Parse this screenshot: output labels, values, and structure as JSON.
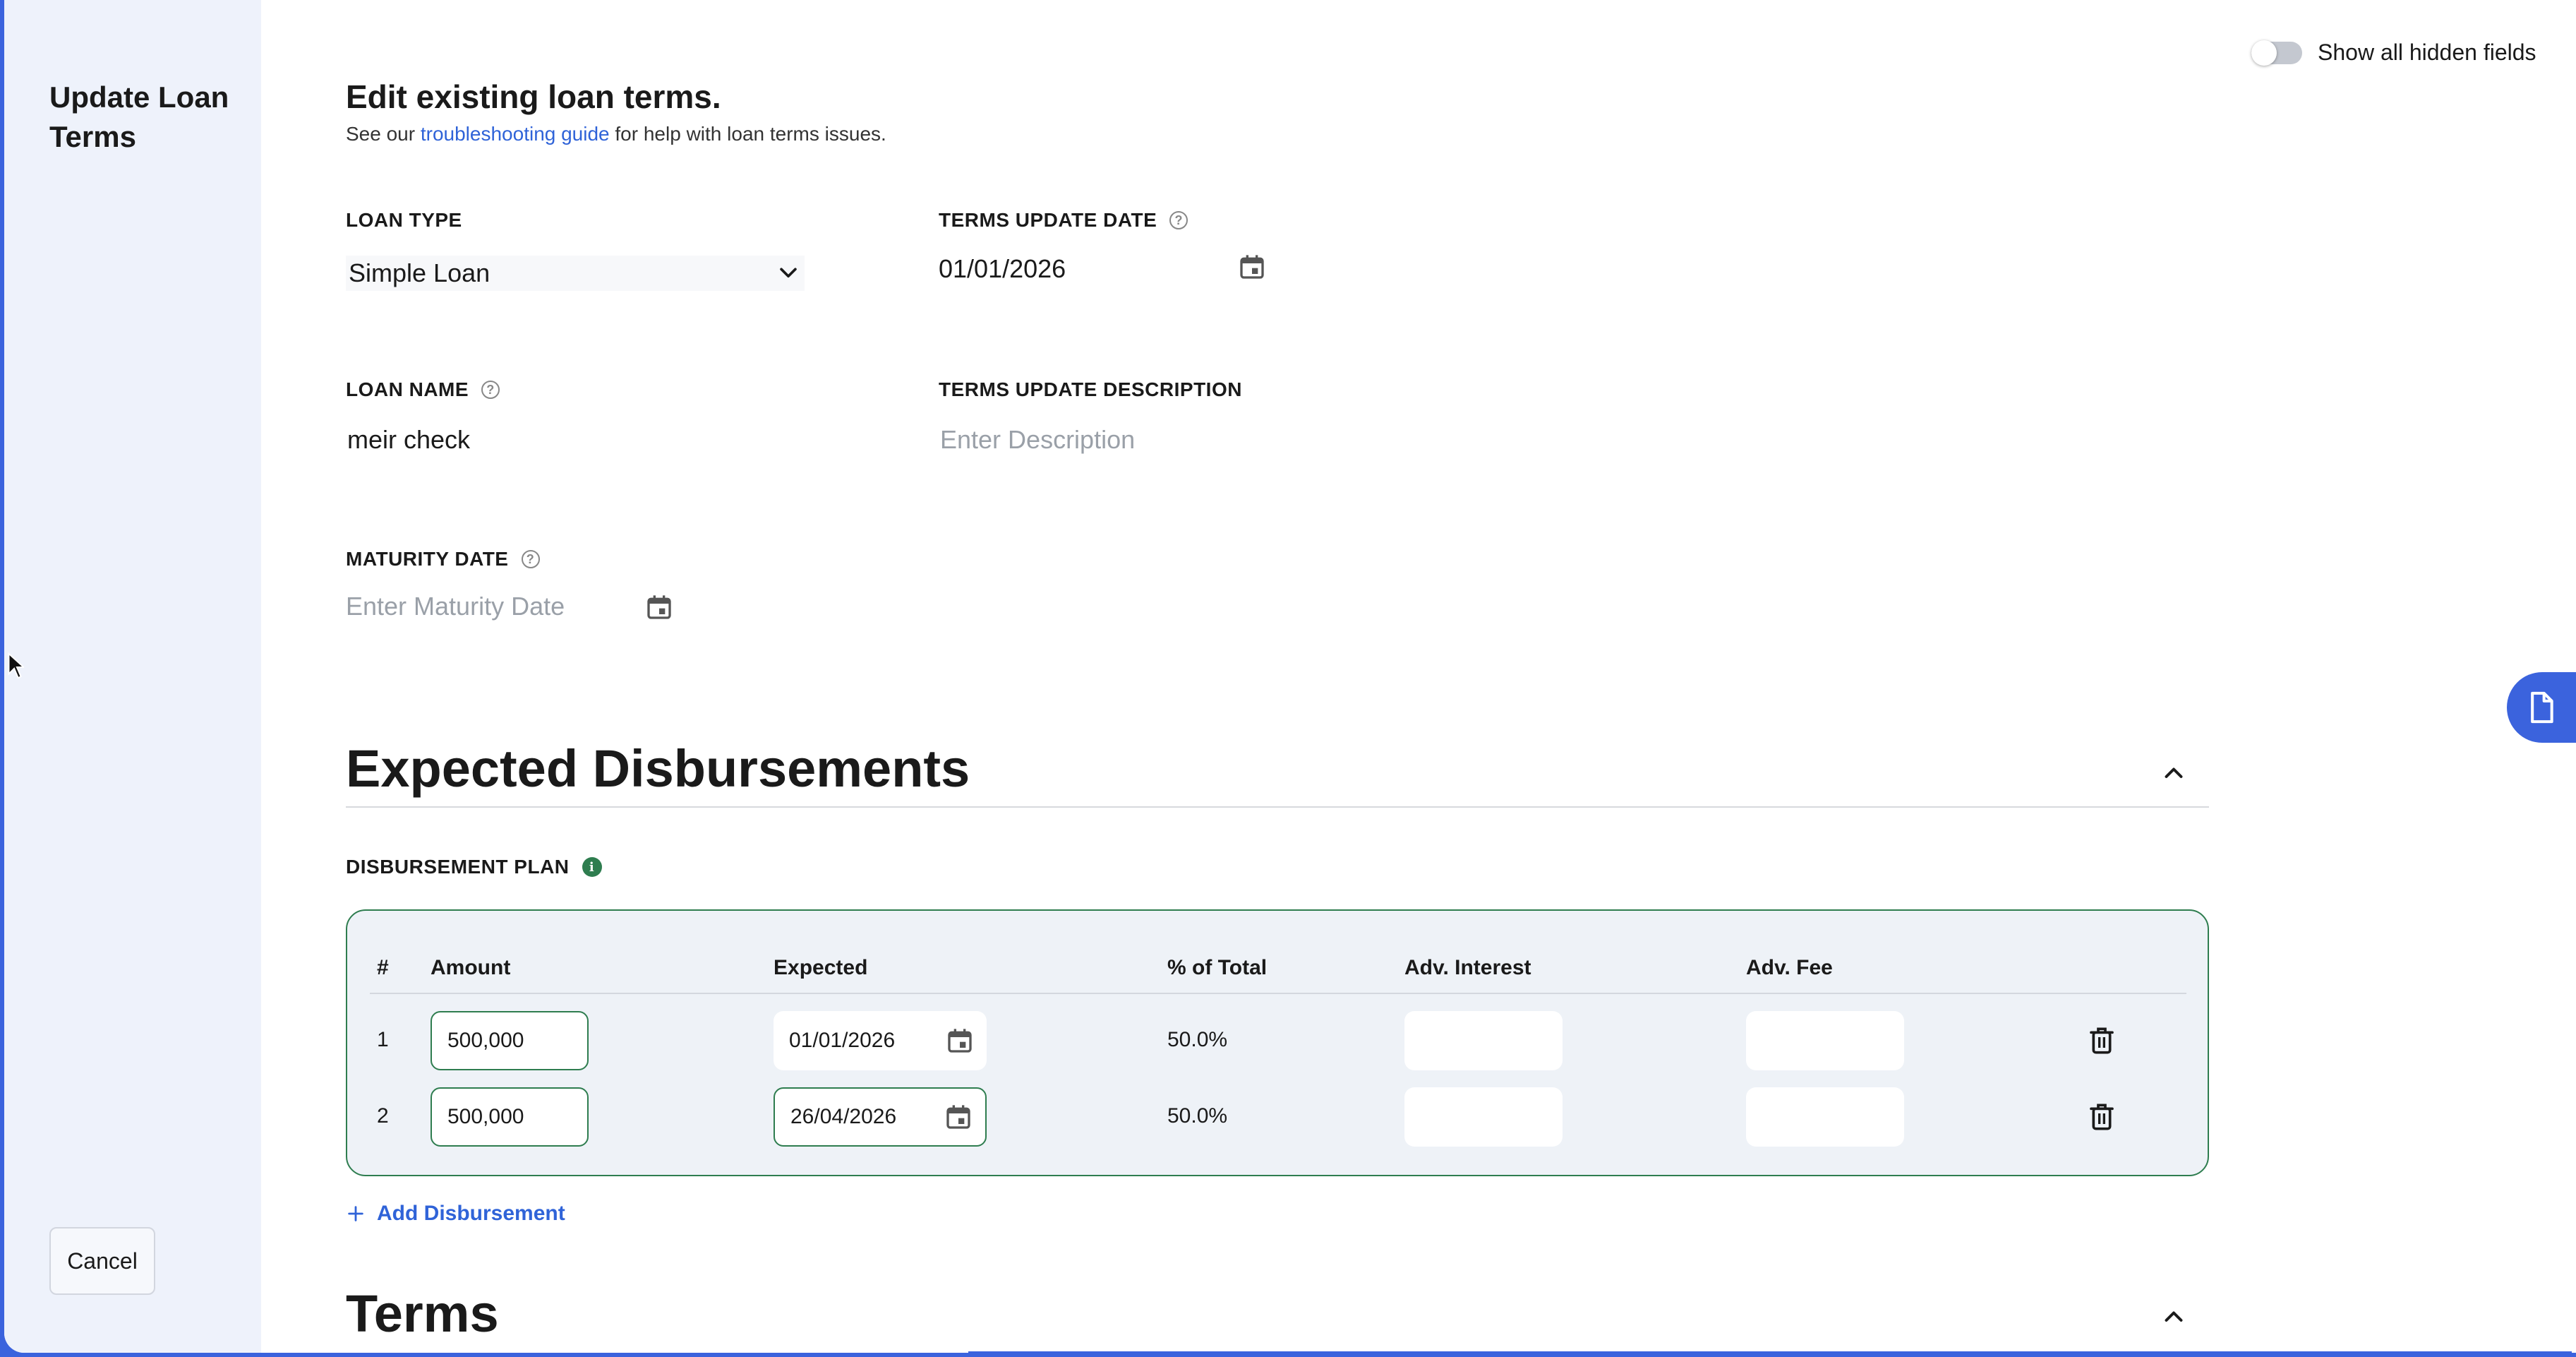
{
  "sidebar": {
    "title": "Update Loan Terms",
    "cancel_label": "Cancel"
  },
  "toggle": {
    "label": "Show all hidden fields",
    "on": false
  },
  "header": {
    "title": "Edit existing loan terms.",
    "sub_before": "See our ",
    "sub_link": "troubleshooting guide",
    "sub_after": " for help with loan terms issues."
  },
  "fields": {
    "loan_type": {
      "label": "LOAN TYPE",
      "value": "Simple Loan"
    },
    "terms_update_date": {
      "label": "TERMS UPDATE DATE",
      "value": "01/01/2026"
    },
    "loan_name": {
      "label": "LOAN NAME",
      "value": "meir check"
    },
    "terms_update_description": {
      "label": "TERMS UPDATE DESCRIPTION",
      "placeholder": "Enter Description"
    },
    "maturity_date": {
      "label": "MATURITY DATE",
      "placeholder": "Enter Maturity Date"
    }
  },
  "disbursements": {
    "section_title": "Expected Disbursements",
    "plan_label": "DISBURSEMENT PLAN",
    "columns": [
      "#",
      "Amount",
      "Expected",
      "% of Total",
      "Adv. Interest",
      "Adv. Fee"
    ],
    "rows": [
      {
        "num": "1",
        "amount": "500,000",
        "expected": "01/01/2026",
        "pct": "50.0%",
        "adv_interest": "",
        "adv_fee": ""
      },
      {
        "num": "2",
        "amount": "500,000",
        "expected": "26/04/2026",
        "pct": "50.0%",
        "adv_interest": "",
        "adv_fee": ""
      }
    ],
    "add_label": "Add Disbursement"
  },
  "terms": {
    "section_title": "Terms"
  },
  "colors": {
    "accent_blue": "#3b63dd",
    "link_blue": "#2f63d8",
    "success_green": "#2e7d4f"
  }
}
